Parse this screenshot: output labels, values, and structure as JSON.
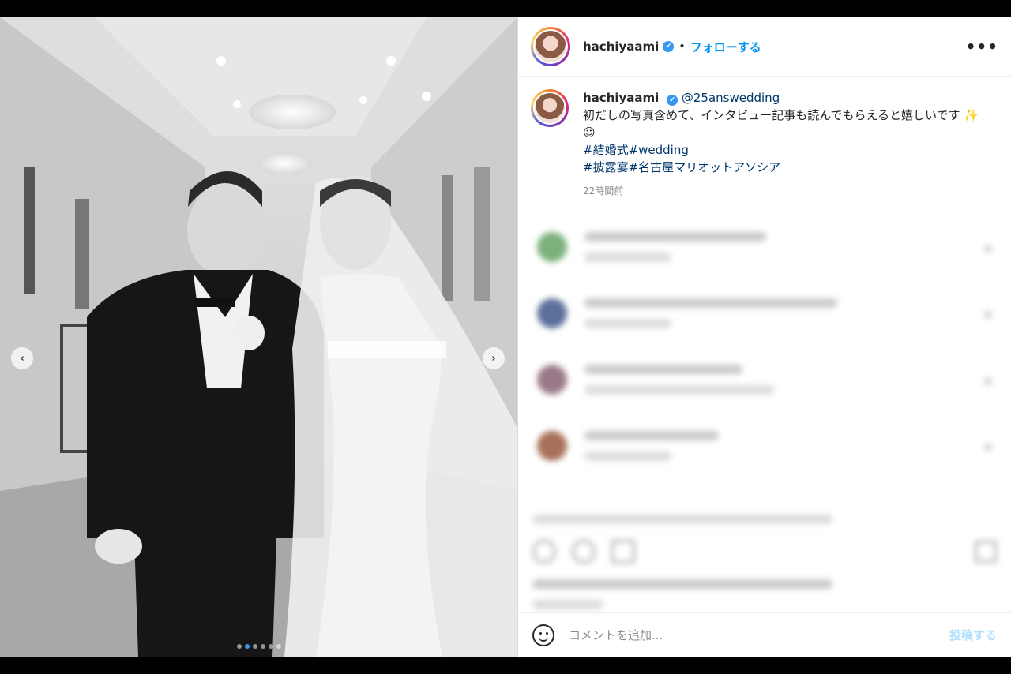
{
  "post": {
    "nav_prev": "‹",
    "nav_next": "›",
    "carousel": {
      "count": 6,
      "active": 1
    }
  },
  "header": {
    "username": "hachiyaami",
    "verified_icon": "✔",
    "separator": "•",
    "follow_label": "フォローする",
    "more_label": "•••"
  },
  "caption": {
    "username": "hachiyaami",
    "verified_icon": "✔",
    "mention": "@25answedding",
    "text": "初だしの写真含めて、インタビュー記事も読んでもらえると嬉しいです",
    "emoji": "✨☺",
    "tags_line1": "#結婚式#wedding",
    "tags_line2": "#披露宴#名古屋マリオットアソシア",
    "time": "22時間前"
  },
  "comment_box": {
    "placeholder": "コメントを追加...",
    "post_label": "投稿する"
  },
  "colors": {
    "accent": "#0095f6",
    "verified": "#3897f0",
    "tag": "#00376b",
    "post_disabled": "#b2dffc"
  }
}
